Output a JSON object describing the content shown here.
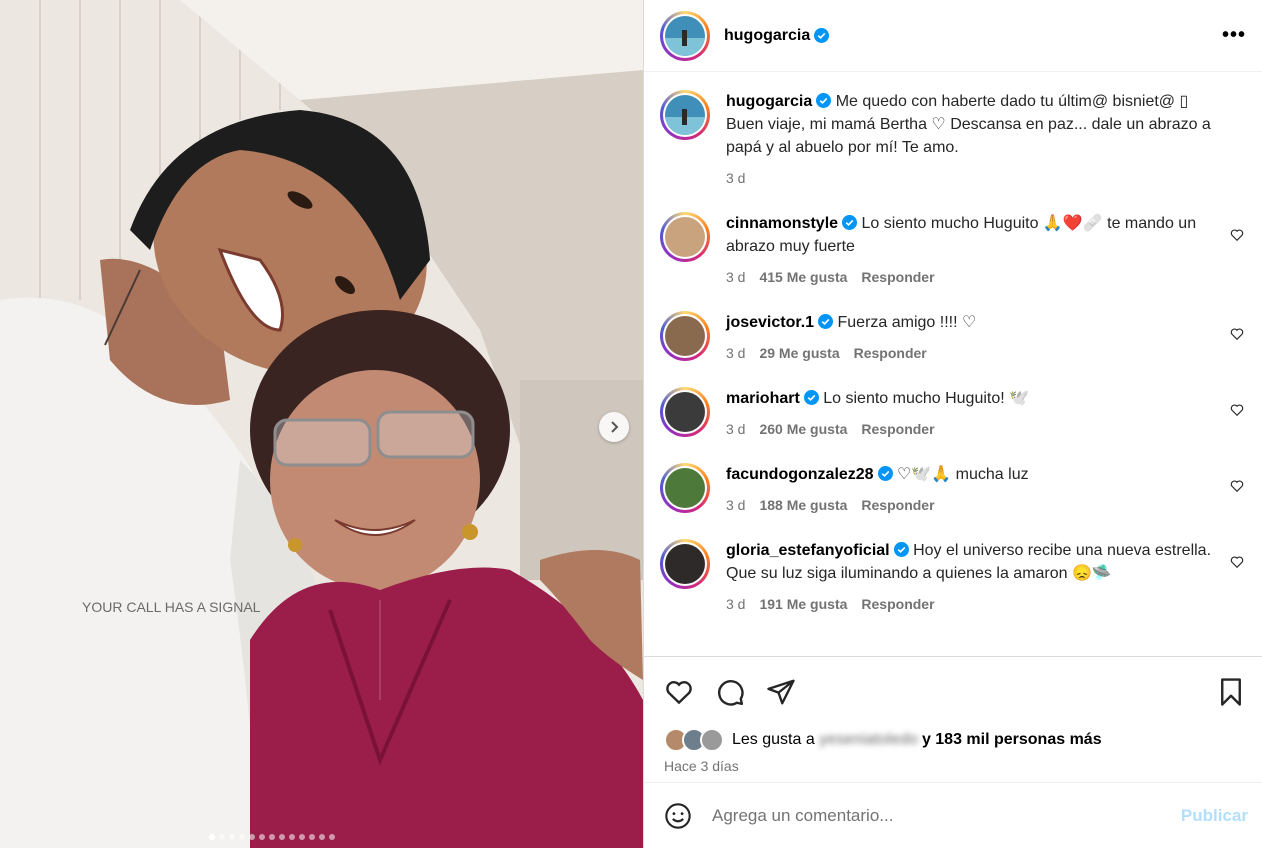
{
  "post": {
    "author": "hugogarcia",
    "more_icon": "more-horizontal-icon",
    "caption": {
      "username": "hugogarcia",
      "text": "Me quedo con haberte dado tu últim@ bisniet@ ▯ Buen viaje, mi mamá Bertha ♡ Descansa en paz... dale un abrazo a papá y al abuelo por mí! Te amo.",
      "time": "3 d"
    },
    "image_text": "YOUR CALL HAS A SIGNAL",
    "carousel_dots": 13
  },
  "comments": [
    {
      "username": "cinnamonstyle",
      "text": "Lo siento mucho Huguito 🙏❤️🩹 te mando un abrazo muy fuerte",
      "time": "3 d",
      "likes": "415 Me gusta",
      "reply": "Responder",
      "avatar_color": "#c9a27e"
    },
    {
      "username": "josevictor.1",
      "text": "Fuerza amigo !!!! ♡",
      "time": "3 d",
      "likes": "29 Me gusta",
      "reply": "Responder",
      "avatar_color": "#8a6a4f"
    },
    {
      "username": "mariohart",
      "text": "Lo siento mucho Huguito! 🕊️",
      "time": "3 d",
      "likes": "260 Me gusta",
      "reply": "Responder",
      "avatar_color": "#3b3b3b"
    },
    {
      "username": "facundogonzalez28",
      "text": "♡🕊️🙏 mucha luz",
      "time": "3 d",
      "likes": "188 Me gusta",
      "reply": "Responder",
      "avatar_color": "#4d7a3a"
    },
    {
      "username": "gloria_estefanyoficial",
      "text": "Hoy el universo recibe una nueva estrella.",
      "text2": "Que su luz siga iluminando a quienes la amaron 😞🛸",
      "time": "3 d",
      "likes": "191 Me gusta",
      "reply": "Responder",
      "avatar_color": "#2f2a2a"
    }
  ],
  "likes": {
    "prefix": "Les gusta a",
    "blurred": "yeseniatoledo",
    "suffix": "y 183 mil personas más",
    "posted": "Hace 3 días"
  },
  "composer": {
    "placeholder": "Agrega un comentario...",
    "publish_label": "Publicar"
  },
  "colors": {
    "verified": "#0095f6",
    "secondary_text": "#737373",
    "publish_disabled": "#b2dffc",
    "shirt_magenta": "#9b1d4a"
  }
}
